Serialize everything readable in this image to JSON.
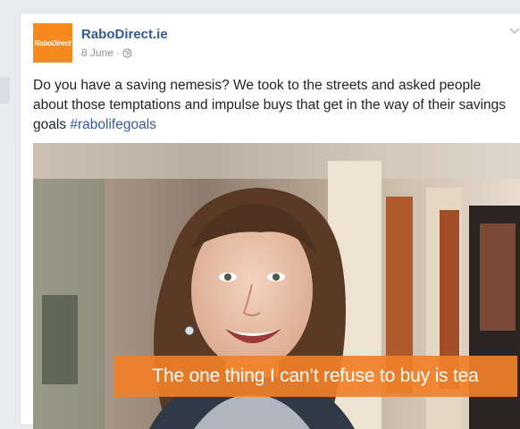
{
  "post": {
    "page_name": "RaboDirect.ie",
    "logo_text": "RaboDirect",
    "date": "8 June",
    "separator": "·",
    "text": "Do you have a saving nemesis? We took to the streets and asked people about those temptations and impulse buys that get in the way of their savings goals",
    "hashtag": "#rabolifegoals"
  },
  "video": {
    "subtitle": "The one thing I can’t refuse to buy is tea"
  },
  "icons": {
    "privacy": "globe-icon",
    "menu": "chevron-down-icon"
  },
  "colors": {
    "brand_orange": "#f68a1f",
    "link_blue": "#365899",
    "subtitle_bg": "#f08028"
  }
}
